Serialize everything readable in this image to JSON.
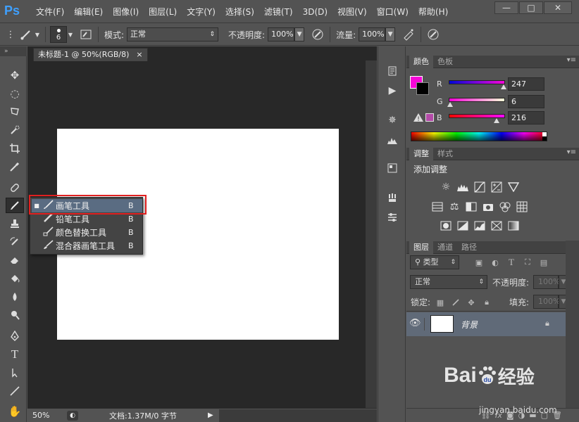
{
  "app": {
    "logo": "Ps",
    "accent": "#3fa0ff"
  },
  "menu": [
    "文件(F)",
    "编辑(E)",
    "图像(I)",
    "图层(L)",
    "文字(Y)",
    "选择(S)",
    "滤镜(T)",
    "3D(D)",
    "视图(V)",
    "窗口(W)",
    "帮助(H)"
  ],
  "window_controls": {
    "minimize": "—",
    "maximize": "□",
    "close": "✕"
  },
  "options": {
    "brush_size": "6",
    "mode_label": "模式:",
    "mode_value": "正常",
    "opacity_label": "不透明度:",
    "opacity_value": "100%",
    "flow_label": "流量:",
    "flow_value": "100%"
  },
  "document": {
    "tab_title": "未标题-1 @ 50%(RGB/8)",
    "tab_close": "×",
    "zoom": "50%",
    "doc_info": "文档:1.37M/0 字节"
  },
  "flyout": {
    "items": [
      {
        "label": "画笔工具",
        "key": "B",
        "selected": true
      },
      {
        "label": "铅笔工具",
        "key": "B",
        "selected": false
      },
      {
        "label": "颜色替换工具",
        "key": "B",
        "selected": false
      },
      {
        "label": "混合器画笔工具",
        "key": "B",
        "selected": false
      }
    ]
  },
  "color_panel": {
    "tabs": [
      "颜色",
      "色板"
    ],
    "foreground": "#f706d8",
    "background": "#000000",
    "r": {
      "label": "R",
      "value": "247"
    },
    "g": {
      "label": "G",
      "value": "6"
    },
    "b": {
      "label": "B",
      "value": "216"
    },
    "r_level": 0.97,
    "g_level": 0.02,
    "b_level": 0.85
  },
  "adjust_panel": {
    "tabs": [
      "调整",
      "样式"
    ],
    "title": "添加调整"
  },
  "layers_panel": {
    "tabs": [
      "图层",
      "通道",
      "路径"
    ],
    "filter": "类型",
    "blend_mode": "正常",
    "opacity_label": "不透明度:",
    "opacity_value": "100%",
    "lock_label": "锁定:",
    "fill_label": "填充:",
    "fill_value": "100%",
    "layer_name": "背景"
  },
  "watermark": {
    "brand": "Bai",
    "brand_suffix": "du",
    "brand_cn": "经验",
    "url": "jingyan.baidu.com"
  }
}
